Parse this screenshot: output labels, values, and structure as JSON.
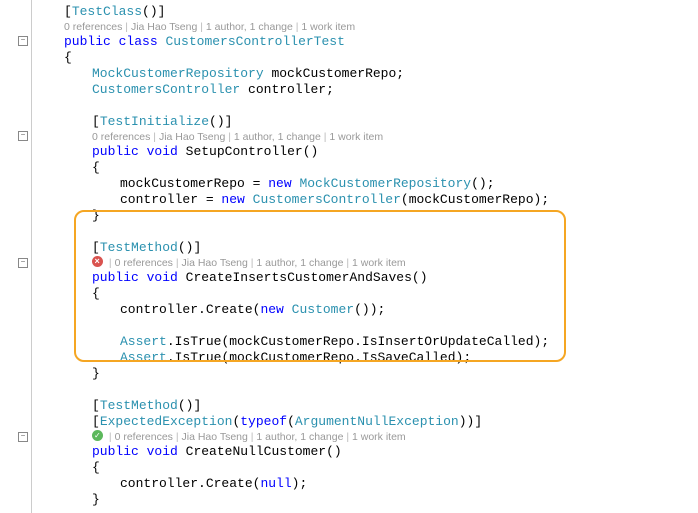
{
  "attr": {
    "testClass": "TestClass",
    "testInitialize": "TestInitialize",
    "testMethod": "TestMethod",
    "expectedException": "ExpectedException",
    "argNullEx": "ArgumentNullException"
  },
  "kw": {
    "public": "public",
    "class": "class",
    "void": "void",
    "new": "new",
    "typeof": "typeof",
    "null": "null"
  },
  "types": {
    "className": "CustomersControllerTest",
    "mockRepo": "MockCustomerRepository",
    "controller": "CustomersController",
    "customer": "Customer"
  },
  "methods": {
    "setup": "SetupController",
    "createSaves": "CreateInsertsCustomerAndSaves",
    "createNull": "CreateNullCustomer"
  },
  "vars": {
    "mockRepo": "mockCustomerRepo",
    "controller": "controller"
  },
  "members": {
    "create": "Create",
    "assert": "Assert",
    "isTrue": "IsTrue",
    "isInsert": "IsInsertOrUpdateCalled",
    "isSave": "IsSaveCalled"
  },
  "codelens": {
    "refs0": "0 references",
    "author": "Jia Hao Tseng",
    "changes": "1 author, 1 change",
    "workitem": "1 work item",
    "sep": " | "
  },
  "braces": {
    "open": "{",
    "close": "}",
    "openParen": "(",
    "closeParen": ")",
    "openBracket": "[",
    "closeBracket": "]",
    "semi": ";",
    "dot": ".",
    "comma": ", ",
    "eq": " = "
  },
  "space": " "
}
